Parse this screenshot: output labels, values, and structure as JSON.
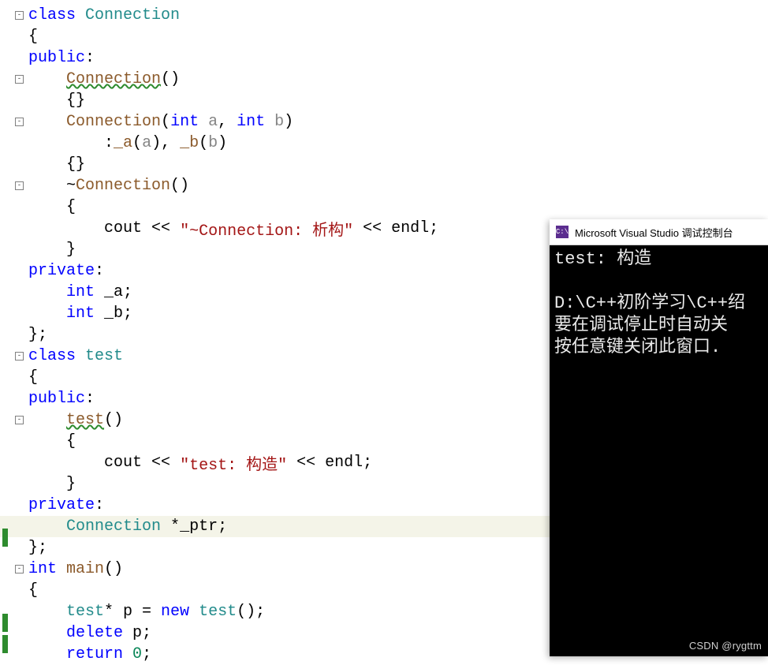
{
  "editor": {
    "lines": [
      {
        "fold": true,
        "tokens": [
          {
            "t": "class ",
            "c": "kw"
          },
          {
            "t": "Connection",
            "c": "cls"
          }
        ]
      },
      {
        "tokens": [
          {
            "t": "{",
            "c": "sym"
          }
        ]
      },
      {
        "tokens": [
          {
            "t": "public",
            "c": "kw"
          },
          {
            "t": ":",
            "c": "sym"
          }
        ]
      },
      {
        "fold": true,
        "tokens": [
          {
            "t": "    ",
            "c": "txt"
          },
          {
            "t": "Connection",
            "c": "func",
            "squig": true
          },
          {
            "t": "()",
            "c": "sym"
          }
        ]
      },
      {
        "tokens": [
          {
            "t": "    {}",
            "c": "sym"
          }
        ]
      },
      {
        "fold": true,
        "tokens": [
          {
            "t": "    ",
            "c": "txt"
          },
          {
            "t": "Connection",
            "c": "func"
          },
          {
            "t": "(",
            "c": "sym"
          },
          {
            "t": "int",
            "c": "kw"
          },
          {
            "t": " a",
            "c": "var"
          },
          {
            "t": ", ",
            "c": "sym"
          },
          {
            "t": "int",
            "c": "kw"
          },
          {
            "t": " b",
            "c": "var"
          },
          {
            "t": ")",
            "c": "sym"
          }
        ]
      },
      {
        "tokens": [
          {
            "t": "        :",
            "c": "sym"
          },
          {
            "t": "_a",
            "c": "func"
          },
          {
            "t": "(",
            "c": "sym"
          },
          {
            "t": "a",
            "c": "var"
          },
          {
            "t": "), ",
            "c": "sym"
          },
          {
            "t": "_b",
            "c": "func"
          },
          {
            "t": "(",
            "c": "sym"
          },
          {
            "t": "b",
            "c": "var"
          },
          {
            "t": ")",
            "c": "sym"
          }
        ]
      },
      {
        "tokens": [
          {
            "t": "    {}",
            "c": "sym"
          }
        ]
      },
      {
        "fold": true,
        "tokens": [
          {
            "t": "    ~",
            "c": "sym"
          },
          {
            "t": "Connection",
            "c": "func"
          },
          {
            "t": "()",
            "c": "sym"
          }
        ]
      },
      {
        "tokens": [
          {
            "t": "    {",
            "c": "sym"
          }
        ]
      },
      {
        "tokens": [
          {
            "t": "        cout ",
            "c": "txt"
          },
          {
            "t": "<<",
            "c": "sym"
          },
          {
            "t": " ",
            "c": "txt"
          },
          {
            "t": "\"~Connection: 析构\"",
            "c": "str"
          },
          {
            "t": " ",
            "c": "txt"
          },
          {
            "t": "<<",
            "c": "sym"
          },
          {
            "t": " endl;",
            "c": "txt"
          }
        ]
      },
      {
        "tokens": [
          {
            "t": "    }",
            "c": "sym"
          }
        ]
      },
      {
        "tokens": [
          {
            "t": "private",
            "c": "kw"
          },
          {
            "t": ":",
            "c": "sym"
          }
        ]
      },
      {
        "tokens": [
          {
            "t": "    ",
            "c": "txt"
          },
          {
            "t": "int",
            "c": "kw"
          },
          {
            "t": " _a;",
            "c": "txt"
          }
        ]
      },
      {
        "tokens": [
          {
            "t": "    ",
            "c": "txt"
          },
          {
            "t": "int",
            "c": "kw"
          },
          {
            "t": " _b;",
            "c": "txt"
          }
        ]
      },
      {
        "tokens": [
          {
            "t": "};",
            "c": "sym"
          }
        ]
      },
      {
        "fold": true,
        "tokens": [
          {
            "t": "class ",
            "c": "kw"
          },
          {
            "t": "test",
            "c": "cls"
          }
        ]
      },
      {
        "tokens": [
          {
            "t": "{",
            "c": "sym"
          }
        ]
      },
      {
        "tokens": [
          {
            "t": "public",
            "c": "kw"
          },
          {
            "t": ":",
            "c": "sym"
          }
        ]
      },
      {
        "fold": true,
        "tokens": [
          {
            "t": "    ",
            "c": "txt"
          },
          {
            "t": "test",
            "c": "func",
            "squig": true
          },
          {
            "t": "()",
            "c": "sym"
          }
        ]
      },
      {
        "tokens": [
          {
            "t": "    {",
            "c": "sym"
          }
        ]
      },
      {
        "tokens": [
          {
            "t": "        cout ",
            "c": "txt"
          },
          {
            "t": "<<",
            "c": "sym"
          },
          {
            "t": " ",
            "c": "txt"
          },
          {
            "t": "\"test: 构造\"",
            "c": "str"
          },
          {
            "t": " ",
            "c": "txt"
          },
          {
            "t": "<<",
            "c": "sym"
          },
          {
            "t": " endl;",
            "c": "txt"
          }
        ]
      },
      {
        "tokens": [
          {
            "t": "    }",
            "c": "sym"
          }
        ]
      },
      {
        "tokens": [
          {
            "t": "private",
            "c": "kw"
          },
          {
            "t": ":",
            "c": "sym"
          }
        ]
      },
      {
        "green": true,
        "highlight": true,
        "tokens": [
          {
            "t": "    ",
            "c": "txt"
          },
          {
            "t": "Connection",
            "c": "cls"
          },
          {
            "t": " *",
            "c": "sym"
          },
          {
            "t": "_ptr",
            "c": "txt"
          },
          {
            "t": ";",
            "c": "sym"
          }
        ]
      },
      {
        "tokens": [
          {
            "t": "};",
            "c": "sym"
          }
        ]
      },
      {
        "fold": true,
        "tokens": [
          {
            "t": "int",
            "c": "kw"
          },
          {
            "t": " ",
            "c": "txt"
          },
          {
            "t": "main",
            "c": "func"
          },
          {
            "t": "()",
            "c": "sym"
          }
        ]
      },
      {
        "tokens": [
          {
            "t": "{",
            "c": "sym"
          }
        ]
      },
      {
        "green": true,
        "tokens": [
          {
            "t": "    ",
            "c": "txt"
          },
          {
            "t": "test",
            "c": "cls"
          },
          {
            "t": "* p = ",
            "c": "txt"
          },
          {
            "t": "new",
            "c": "kw"
          },
          {
            "t": " ",
            "c": "txt"
          },
          {
            "t": "test",
            "c": "cls"
          },
          {
            "t": "();",
            "c": "sym"
          }
        ]
      },
      {
        "green": true,
        "tokens": [
          {
            "t": "    ",
            "c": "txt"
          },
          {
            "t": "delete",
            "c": "kw"
          },
          {
            "t": " p;",
            "c": "txt"
          }
        ]
      },
      {
        "tokens": [
          {
            "t": "    ",
            "c": "txt"
          },
          {
            "t": "return",
            "c": "kw"
          },
          {
            "t": " ",
            "c": "txt"
          },
          {
            "t": "0",
            "c": "num"
          },
          {
            "t": ";",
            "c": "sym"
          }
        ]
      }
    ]
  },
  "console": {
    "title": "Microsoft Visual Studio 调试控制台",
    "icon_text": "C:\\",
    "output": [
      "test: 构造",
      "",
      "D:\\C++初阶学习\\C++绍",
      "要在调试停止时自动关",
      "按任意键关闭此窗口."
    ]
  },
  "watermark": "CSDN @rygttm"
}
